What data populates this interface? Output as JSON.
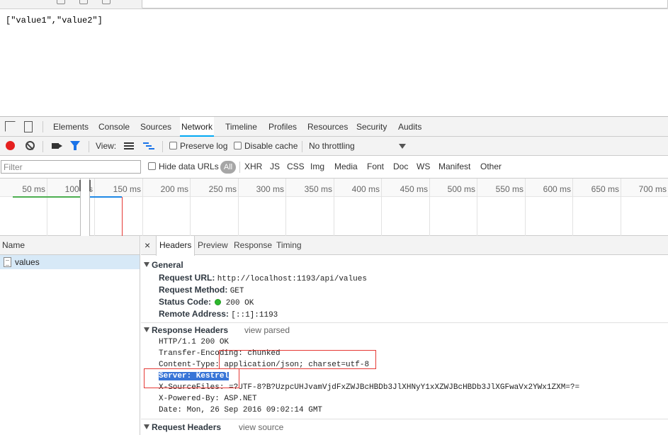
{
  "page": {
    "body_text": "[\"value1\",\"value2\"]"
  },
  "devtools": {
    "tabs": [
      "Elements",
      "Console",
      "Sources",
      "Network",
      "Timeline",
      "Profiles",
      "Resources",
      "Security",
      "Audits"
    ],
    "active_tab": "Network",
    "toolbar": {
      "view_label": "View:",
      "preserve_log": "Preserve log",
      "disable_cache": "Disable cache",
      "throttling": "No throttling"
    },
    "filter": {
      "placeholder": "Filter",
      "hide_data_urls": "Hide data URLs",
      "all": "All",
      "types": [
        "XHR",
        "JS",
        "CSS",
        "Img",
        "Media",
        "Font",
        "Doc",
        "WS",
        "Manifest",
        "Other"
      ]
    },
    "timeline_ticks": [
      "50 ms",
      "100 ms",
      "150 ms",
      "200 ms",
      "250 ms",
      "300 ms",
      "350 ms",
      "400 ms",
      "450 ms",
      "500 ms",
      "550 ms",
      "600 ms",
      "650 ms",
      "700 ms"
    ],
    "requests": {
      "header": "Name",
      "items": [
        "values"
      ]
    },
    "detail_tabs": {
      "close": "×",
      "headers": "Headers",
      "preview": "Preview",
      "response": "Response",
      "timing": "Timing"
    },
    "general": {
      "title": "General",
      "request_url_key": "Request URL:",
      "request_url": "http://localhost:1193/api/values",
      "request_method_key": "Request Method:",
      "request_method": "GET",
      "status_code_key": "Status Code:",
      "status_code": "200 OK",
      "remote_address_key": "Remote Address:",
      "remote_address": "[::1]:1193"
    },
    "response_headers": {
      "title": "Response Headers",
      "view_parsed": "view parsed",
      "lines": [
        "HTTP/1.1 200 OK",
        "Transfer-Encoding: chunked",
        "Content-Type: application/json; charset=utf-8",
        "Server: Kestrel",
        "X-SourceFiles: =?UTF-8?B?UzpcUHJvamVjdFxZWJBcHBDb3JlXHNyY1xXZWJBcHBDb3JlXGFwaVx2YWx1ZXM=?=",
        "X-Powered-By: ASP.NET",
        "Date: Mon, 26 Sep 2016 09:02:14 GMT"
      ]
    },
    "request_headers": {
      "title": "Request Headers",
      "view_source": "view source"
    }
  }
}
